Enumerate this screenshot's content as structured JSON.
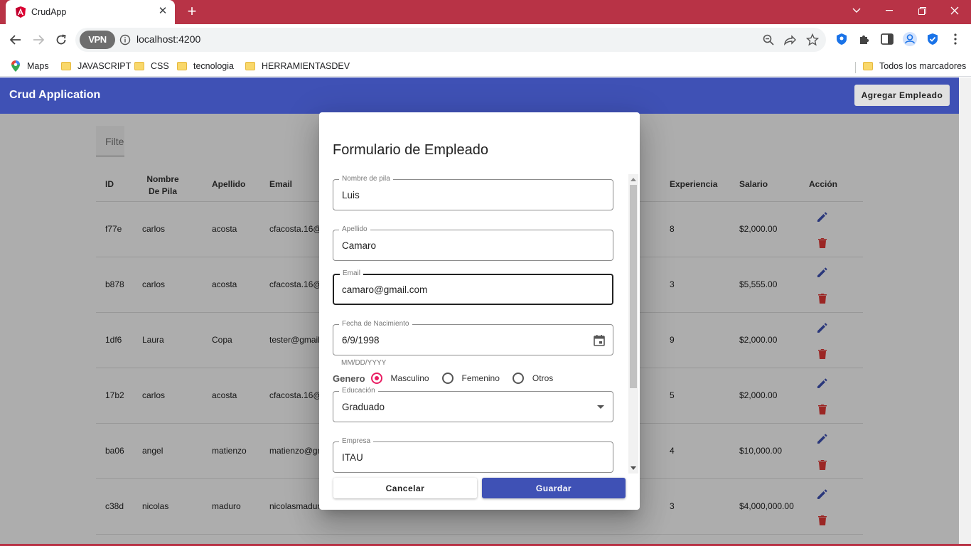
{
  "browser": {
    "tab_title": "CrudApp",
    "url": "localhost:4200",
    "vpn_label": "VPN",
    "bookmarks": [
      "Maps",
      "JAVASCRIPT",
      "CSS",
      "tecnologia",
      "HERRAMIENTASDEV"
    ],
    "all_bookmarks": "Todos los marcadores",
    "colors": {
      "tabstrip": "#b83346"
    }
  },
  "app": {
    "title": "Crud Application",
    "add_button": "Agregar Empleado",
    "filter_placeholder": "Filter",
    "accent": "#3f51b5",
    "columns": [
      "ID",
      "Nombre De Pila",
      "Apellido",
      "Email",
      "Experiencia",
      "Salario",
      "Acción"
    ],
    "rows": [
      {
        "id": "f77e",
        "nombre": "carlos",
        "apellido": "acosta",
        "email": "cfacosta.16@",
        "experiencia": "8",
        "salario": "$2,000.00"
      },
      {
        "id": "b878",
        "nombre": "carlos",
        "apellido": "acosta",
        "email": "cfacosta.16@",
        "experiencia": "3",
        "salario": "$5,555.00"
      },
      {
        "id": "1df6",
        "nombre": "Laura",
        "apellido": "Copa",
        "email": "tester@gmail",
        "experiencia": "9",
        "salario": "$2,000.00"
      },
      {
        "id": "17b2",
        "nombre": "carlos",
        "apellido": "acosta",
        "email": "cfacosta.16@",
        "experiencia": "5",
        "salario": "$2,000.00"
      },
      {
        "id": "ba06",
        "nombre": "angel",
        "apellido": "matienzo",
        "email": "matienzo@gn",
        "experiencia": "4",
        "salario": "$10,000.00"
      },
      {
        "id": "c38d",
        "nombre": "nicolas",
        "apellido": "maduro",
        "email": "nicolasmadur",
        "experiencia": "3",
        "salario": "$4,000,000.00"
      }
    ]
  },
  "dialog": {
    "title": "Formulario de Empleado",
    "fields": {
      "nombre": {
        "label": "Nombre de pila",
        "value": "Luis"
      },
      "apellido": {
        "label": "Apellido",
        "value": "Camaro"
      },
      "email": {
        "label": "Email",
        "value": "camaro@gmail.com"
      },
      "fecha": {
        "label": "Fecha de Nacimiento",
        "value": "6/9/1998",
        "hint": "MM/DD/YYYY"
      },
      "educacion": {
        "label": "Educación",
        "value": "Graduado"
      },
      "empresa": {
        "label": "Empresa",
        "value": "ITAU"
      }
    },
    "genero": {
      "label": "Genero",
      "options": [
        "Masculino",
        "Femenino",
        "Otros"
      ],
      "selected": "Masculino"
    },
    "cancel": "Cancelar",
    "save": "Guardar"
  }
}
